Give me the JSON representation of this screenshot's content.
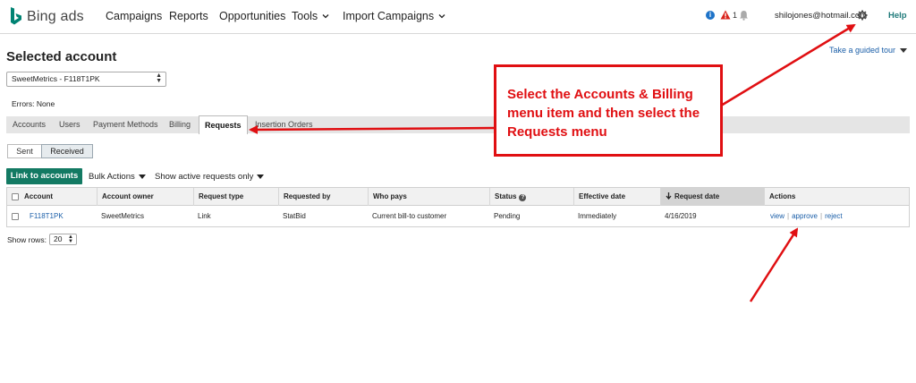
{
  "brand": {
    "name": "Bing ads"
  },
  "nav": {
    "items": [
      "Campaigns",
      "Reports",
      "Opportunities",
      "Tools",
      "Import Campaigns"
    ],
    "alert_count": "1",
    "user_email": "shilojones@hotmail.com",
    "help": "Help"
  },
  "header": {
    "title": "Selected account",
    "guided_tour": "Take a guided tour",
    "account_selected": "SweetMetrics - F118T1PK",
    "errors": "Errors: None"
  },
  "tabs": [
    "Accounts",
    "Users",
    "Payment Methods",
    "Billing",
    "Requests",
    "Insertion Orders"
  ],
  "toggle": {
    "sent": "Sent",
    "received": "Received"
  },
  "actions": {
    "link_accounts": "Link to accounts",
    "bulk_actions": "Bulk Actions",
    "show_active": "Show active requests only"
  },
  "table": {
    "columns": [
      "Account",
      "Account owner",
      "Request type",
      "Requested by",
      "Who pays",
      "Status",
      "Effective date",
      "Request date",
      "Actions"
    ],
    "rows": [
      {
        "account": "F118T1PK",
        "owner": "SweetMetrics",
        "type": "Link",
        "requested_by": "StatBid",
        "who_pays": "Current bill-to customer",
        "status": "Pending",
        "effective": "Immediately",
        "request_date": "4/16/2019",
        "actions": [
          "view",
          "approve",
          "reject"
        ]
      }
    ]
  },
  "pager": {
    "label": "Show rows:",
    "value": "20"
  },
  "callout": {
    "text": "Select the Accounts & Billing menu item and then select the Requests menu"
  },
  "colors": {
    "accent_green": "#137a63",
    "link_blue": "#1a5ea8",
    "annotation_red": "#e00f12",
    "bing_teal": "#008373"
  }
}
